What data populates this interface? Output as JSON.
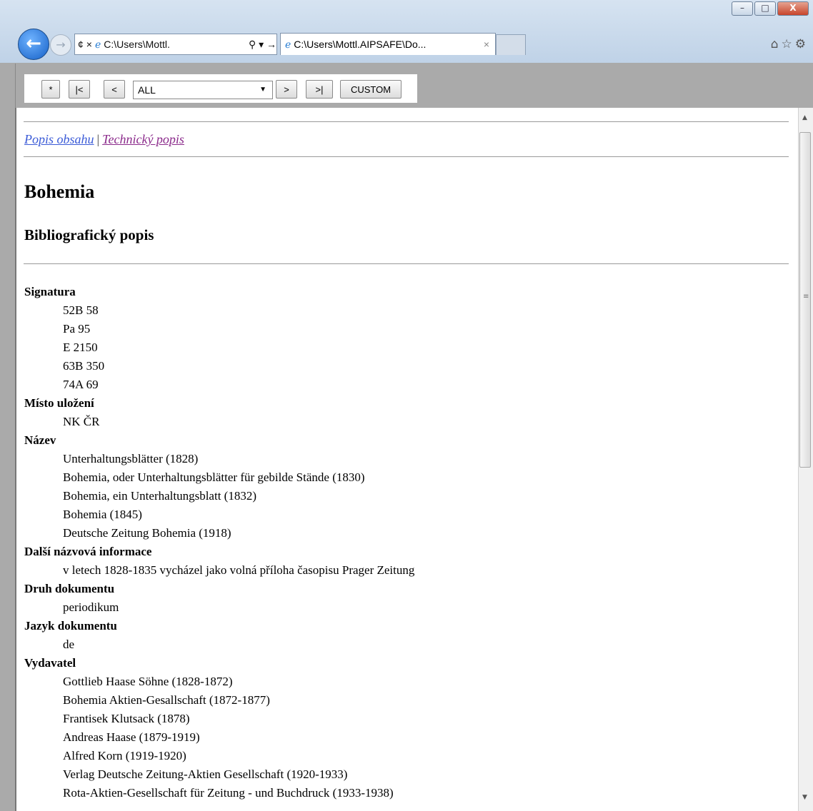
{
  "browser": {
    "address": "C:\\Users\\Mottl.",
    "tab_title": "C:\\Users\\Mottl.AIPSAFE\\Do...",
    "tab_close": "×",
    "window_buttons": [
      "▭",
      "□",
      "X"
    ]
  },
  "toolbar": {
    "star": "*",
    "first": "|<",
    "prev": "<",
    "select_value": "ALL",
    "next": ">",
    "last": ">|",
    "custom": "CUSTOM"
  },
  "links": {
    "popis_obsahu": "Popis obsahu",
    "separator": "|",
    "technicky_popis": "Technický popis"
  },
  "page": {
    "title": "Bohemia",
    "subtitle": "Bibliografický popis"
  },
  "fields": [
    {
      "label": "Signatura",
      "values": [
        "52B 58",
        "Pa 95",
        "E 2150",
        "63B 350",
        "74A 69"
      ]
    },
    {
      "label": "Místo uložení",
      "values": [
        "NK ČR"
      ]
    },
    {
      "label": "Název",
      "values": [
        "Unterhaltungsblätter (1828)",
        "Bohemia, oder Unterhaltungsblätter für gebilde Stände (1830)",
        "Bohemia, ein Unterhaltungsblatt (1832)",
        "Bohemia (1845)",
        "Deutsche Zeitung Bohemia (1918)"
      ]
    },
    {
      "label": "Další názvová informace",
      "values": [
        "v letech 1828-1835 vycházel jako volná příloha časopisu Prager Zeitung"
      ]
    },
    {
      "label": "Druh dokumentu",
      "values": [
        "periodikum"
      ]
    },
    {
      "label": "Jazyk dokumentu",
      "values": [
        "de"
      ]
    },
    {
      "label": "Vydavatel",
      "values": [
        "Gottlieb Haase Söhne (1828-1872)",
        "Bohemia Aktien-Gesallschaft (1872-1877)",
        "Frantisek Klutsack (1878)",
        "Andreas Haase (1879-1919)",
        "Alfred Korn (1919-1920)",
        "Verlag Deutsche Zeitung-Aktien Gesellschaft (1920-1933)",
        "Rota-Aktien-Gesellschaft für Zeitung - und Buchdruck (1933-1938)"
      ]
    }
  ]
}
